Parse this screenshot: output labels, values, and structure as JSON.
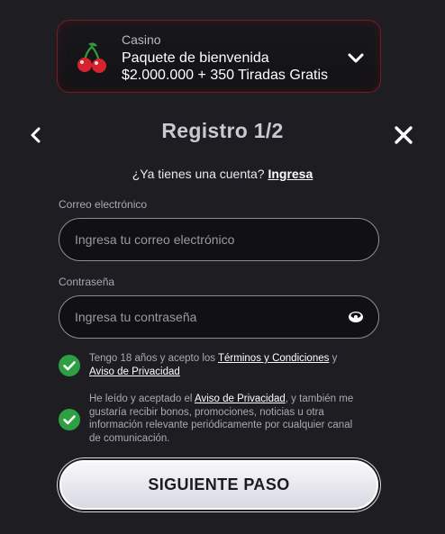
{
  "promo": {
    "category": "Casino",
    "title": "Paquete de bienvenida",
    "subtitle": "$2.000.000 + 350 Tiradas Gratis",
    "icon": "cherries-icon"
  },
  "header": {
    "title": "Registro 1/2",
    "back_icon": "chevron-left-icon",
    "close_icon": "close-icon"
  },
  "account": {
    "prompt": "¿Ya tienes una cuenta?",
    "link": "Ingresa"
  },
  "email": {
    "label": "Correo electrónico",
    "placeholder": "Ingresa tu correo electrónico",
    "value": ""
  },
  "password": {
    "label": "Contraseña",
    "placeholder": "Ingresa tu contraseña",
    "value": ""
  },
  "terms": {
    "checked": true,
    "text_1": "Tengo 18 años y acepto los ",
    "link_1": "Términos y Condiciones",
    "text_2": " y ",
    "link_2": "Aviso de Privacidad"
  },
  "marketing": {
    "checked": true,
    "text_1": "He leído y aceptado el ",
    "link_1": "Aviso de Privacidad",
    "text_2": ", y también me gustaría recibir bonos, promociones, noticias u otra información relevante periódicamente por cualquier canal de comunicación."
  },
  "submit": {
    "label": "SIGUIENTE PASO"
  },
  "colors": {
    "background": "#1e1e22",
    "promo_border": "#7a1a24",
    "check_green": "#2ea043",
    "cherry_red": "#d8232f"
  }
}
